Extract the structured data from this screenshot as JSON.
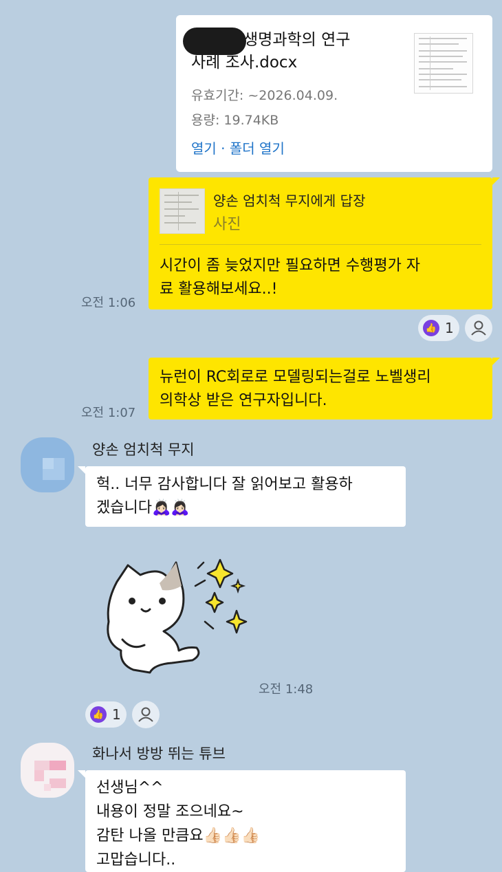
{
  "file_message": {
    "file_name": "생명과학의 연구 사례 조사.docx",
    "file_name_line1": "생명과학의 연구",
    "file_name_line2": "사례 조사.docx",
    "validity_label": "유효기간: ~2026.04.09.",
    "size_label": "용량: 19.74KB",
    "open_link": "열기",
    "separator": " · ",
    "folder_link": "폴더 열기"
  },
  "reply_message": {
    "reply_to": "양손 엄치척 무지에게 답장",
    "reply_kind": "사진",
    "text_line1": "시간이 좀 늦었지만 필요하면 수행평가 자",
    "text_line2": "료 활용해보세요..!",
    "time": "오전 1:06",
    "reaction_count": "1"
  },
  "message_rc": {
    "text_line1": "뉴런이 RC회로로 모델링되는걸로 노벨생리",
    "text_line2": "의학상 받은 연구자입니다.",
    "time": "오전 1:07"
  },
  "user1": {
    "name": "양손 엄치척 무지",
    "text_line1": "헉.. 너무 감사합니다 잘 읽어보고 활용하",
    "text_line2": "겠습니다🙇🏻‍♀️🙇🏻‍♀️",
    "sticker_time": "오전 1:48",
    "reaction_count": "1"
  },
  "user2": {
    "name": "화나서 방방 뛰는 튜브",
    "lines": [
      "선생님^^",
      "내용이 정말 조으네요~",
      "감탄 나올 만큼요👍🏻👍🏻👍🏻",
      "고맙습니다.."
    ]
  },
  "colors": {
    "background": "#bacee0",
    "my_bubble": "#fee500",
    "link": "#1e73c8",
    "like": "#7a3fe0"
  },
  "icons": [
    "thumbs-up-icon",
    "person-icon",
    "sparkle-icon",
    "cat-sticker"
  ]
}
